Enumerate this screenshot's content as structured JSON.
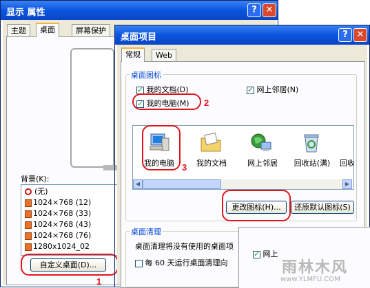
{
  "back_window": {
    "title": "显示 属性",
    "help_btn": "?",
    "close_btn": "✕",
    "tabs": [
      "主题",
      "桌面",
      "屏幕保护"
    ],
    "background_label": "背景(K):",
    "background_items": [
      "(无)",
      "1024×768  (12)",
      "1024×768  (33)",
      "1024×768  (43)",
      "1024×768  (76)",
      "1280x1024_02"
    ],
    "customize_button": "自定义桌面(D)...",
    "annotation_1": "1"
  },
  "front_window": {
    "title": "桌面项目",
    "help_btn": "?",
    "close_btn": "✕",
    "tabs": [
      "常规",
      "Web"
    ],
    "desktop_icons_group": "桌面图标",
    "checkboxes": {
      "my_documents": "我的文档(D)",
      "network_places": "网上邻居(N)",
      "my_computer": "我的电脑(M)"
    },
    "icon_items": [
      "我的电脑",
      "我的文档",
      "网上邻居",
      "回收站(满)",
      "回收"
    ],
    "change_icon_button": "更改图标(H)...",
    "restore_default_button": "还原默认图标(S)",
    "cleanup_group": "桌面清理",
    "cleanup_text": "桌面清理将没有使用的桌面项",
    "cleanup_checkbox": "每 60 天运行桌面清理向",
    "annotation_2": "2",
    "annotation_3": "3"
  },
  "overlay": {
    "checkbox_label": "网上",
    "watermark_text": "雨林木风",
    "watermark_url": "www.YLMFU.COM"
  }
}
